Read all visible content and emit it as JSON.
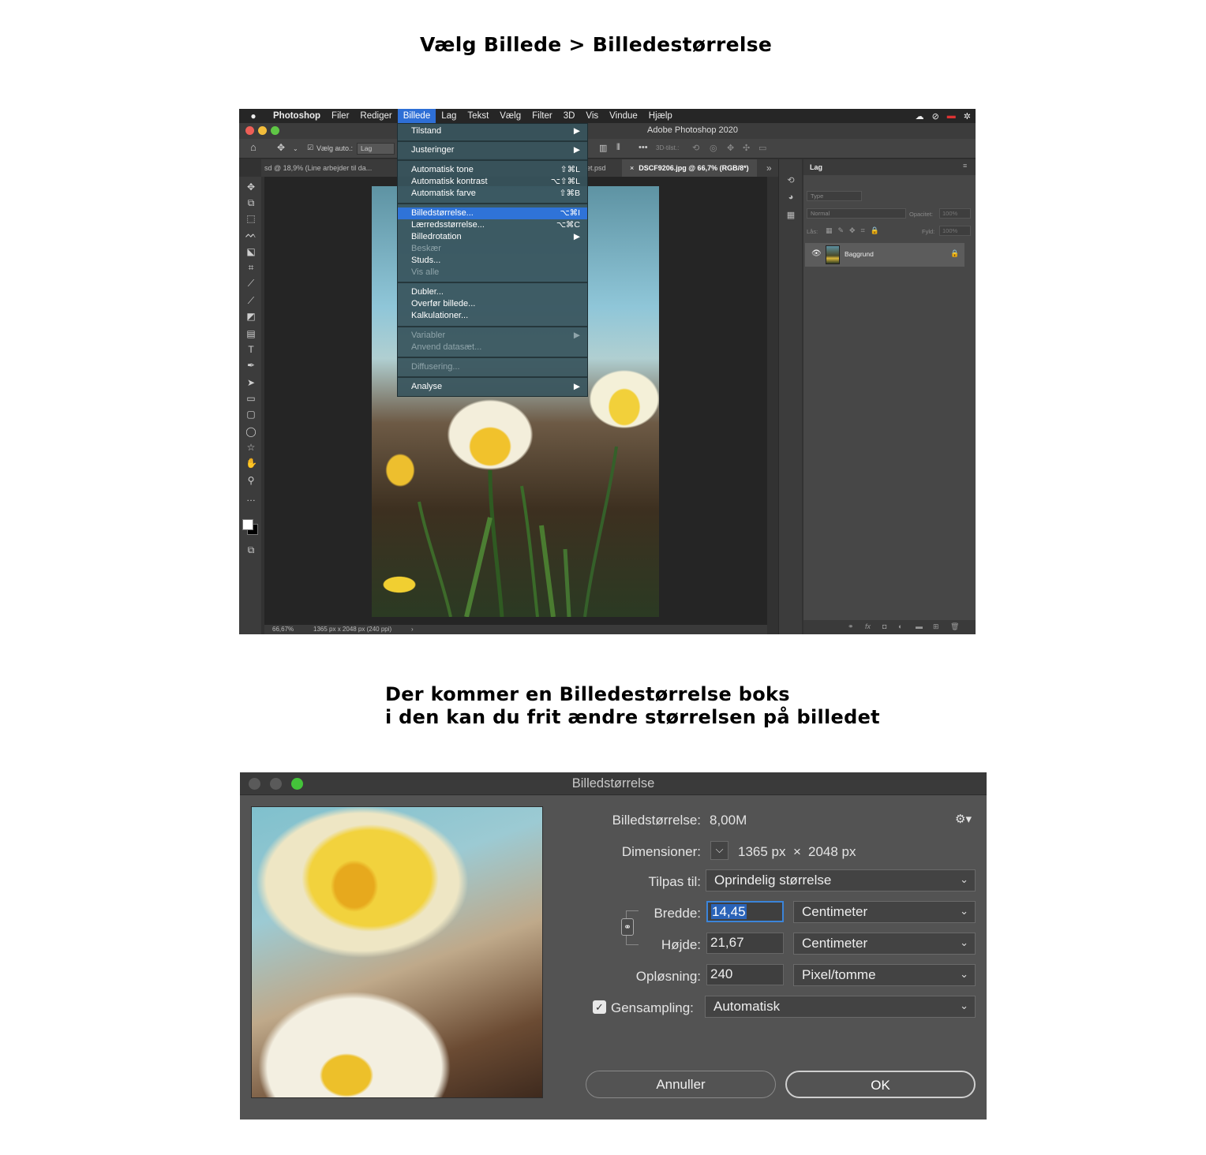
{
  "headings": {
    "step1": "Vælg Billede > Billedestørrelse",
    "step2_line1": "Der kommer en Billedestørrelse boks",
    "step2_line2": "i den kan du frit ændre størrelsen på billedet"
  },
  "photoshop": {
    "menubar": {
      "apple": "",
      "app": "Photoshop",
      "items": [
        "Filer",
        "Rediger",
        "Billede",
        "Lag",
        "Tekst",
        "Vælg",
        "Filter",
        "3D",
        "Vis",
        "Vindue",
        "Hjælp"
      ],
      "active_item": "Billede"
    },
    "window_title": "Adobe Photoshop 2020",
    "options": {
      "auto_select_label": "Vælg auto.:",
      "auto_select_value": "Lag",
      "mode_3d": "3D-tilst.:"
    },
    "tabs": {
      "tab1": "sd @ 18,9% (Line arbejder til da...",
      "tab2": "et.psd",
      "tab3": "DSCF9206.jpg @ 66,7% (RGB/8*)",
      "overflow": "»"
    },
    "status": {
      "zoom": "66,67%",
      "info": "1365 px x 2048 px (240 ppi)",
      "arrow": "›"
    },
    "layers_panel": {
      "title": "Lag",
      "filter_placeholder": "Type",
      "blend_mode": "Normal",
      "opacity_label": "Opacitet:",
      "opacity_value": "100%",
      "lock_label": "Lås:",
      "fill_label": "Fyld:",
      "fill_value": "100%",
      "layer_name": "Baggrund"
    },
    "billede_menu": [
      {
        "label": "Tilstand",
        "shortcut": "",
        "submenu": true,
        "disabled": false
      },
      {
        "label": "Justeringer",
        "shortcut": "",
        "submenu": true,
        "disabled": false
      },
      {
        "label": "Automatisk tone",
        "shortcut": "⇧⌘L",
        "submenu": false,
        "disabled": false
      },
      {
        "label": "Automatisk kontrast",
        "shortcut": "⌥⇧⌘L",
        "submenu": false,
        "disabled": false
      },
      {
        "label": "Automatisk farve",
        "shortcut": "⇧⌘B",
        "submenu": false,
        "disabled": false
      },
      {
        "label": "Billedstørrelse...",
        "shortcut": "⌥⌘I",
        "submenu": false,
        "disabled": false,
        "highlighted": true
      },
      {
        "label": "Lærredsstørrelse...",
        "shortcut": "⌥⌘C",
        "submenu": false,
        "disabled": false
      },
      {
        "label": "Billedrotation",
        "shortcut": "",
        "submenu": true,
        "disabled": false
      },
      {
        "label": "Beskær",
        "shortcut": "",
        "submenu": false,
        "disabled": true
      },
      {
        "label": "Studs...",
        "shortcut": "",
        "submenu": false,
        "disabled": false
      },
      {
        "label": "Vis alle",
        "shortcut": "",
        "submenu": false,
        "disabled": true
      },
      {
        "label": "Dubler...",
        "shortcut": "",
        "submenu": false,
        "disabled": false
      },
      {
        "label": "Overfør billede...",
        "shortcut": "",
        "submenu": false,
        "disabled": false
      },
      {
        "label": "Kalkulationer...",
        "shortcut": "",
        "submenu": false,
        "disabled": false
      },
      {
        "label": "Variabler",
        "shortcut": "",
        "submenu": true,
        "disabled": true
      },
      {
        "label": "Anvend datasæt...",
        "shortcut": "",
        "submenu": false,
        "disabled": true
      },
      {
        "label": "Diffusering...",
        "shortcut": "",
        "submenu": false,
        "disabled": true
      },
      {
        "label": "Analyse",
        "shortcut": "",
        "submenu": true,
        "disabled": false
      }
    ]
  },
  "dialog": {
    "title": "Billedstørrelse",
    "image_size_label": "Billedstørrelse:",
    "image_size_value": "8,00M",
    "dimensions_label": "Dimensioner:",
    "dimensions_width": "1365 px",
    "dimensions_x": "×",
    "dimensions_height": "2048 px",
    "fit_label": "Tilpas til:",
    "fit_value": "Oprindelig størrelse",
    "width_label": "Bredde:",
    "width_value": "14,45",
    "width_unit": "Centimeter",
    "height_label": "Højde:",
    "height_value": "21,67",
    "height_unit": "Centimeter",
    "resolution_label": "Opløsning:",
    "resolution_value": "240",
    "resolution_unit": "Pixel/tomme",
    "resample_label": "Gensampling:",
    "resample_checked": true,
    "resample_value": "Automatisk",
    "cancel_button": "Annuller",
    "ok_button": "OK"
  },
  "colors": {
    "menu_highlight": "#2f73d8",
    "dialog_bg": "#535353",
    "field_focus": "#3b84d9"
  }
}
